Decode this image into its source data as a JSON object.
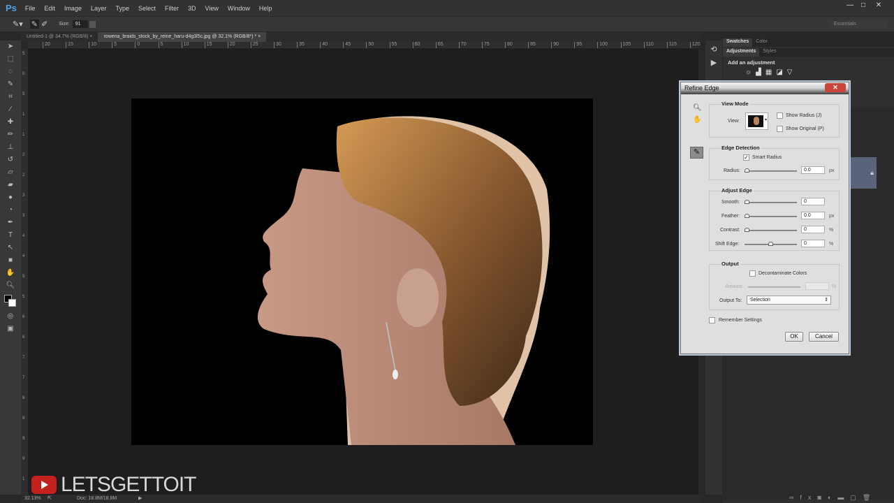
{
  "app": {
    "logo": "Ps",
    "menu": [
      "File",
      "Edit",
      "Image",
      "Layer",
      "Type",
      "Select",
      "Filter",
      "3D",
      "View",
      "Window",
      "Help"
    ],
    "window_buttons": [
      "—",
      "□",
      "✕"
    ],
    "workspace": "Essentials"
  },
  "options": {
    "size_label": "Size:",
    "size_value": "91"
  },
  "tabs": [
    {
      "label": "Untitled-1 @ 34.7% (RGB/8)",
      "close": "×"
    },
    {
      "label": "rowena_braids_stock_by_reine_haru-d4g3l5c.jpg @ 32.1% (RGB/8*) *",
      "close": "×"
    }
  ],
  "ruler_top": [
    "20",
    "15",
    "10",
    "5",
    "0",
    "5",
    "10",
    "15",
    "20",
    "25",
    "30",
    "35",
    "40",
    "45",
    "50",
    "55",
    "60",
    "65",
    "70",
    "75",
    "80",
    "85",
    "90",
    "95",
    "100",
    "105",
    "110",
    "115",
    "120"
  ],
  "ruler_left": [
    "5",
    "0",
    "5",
    "1",
    "1",
    "2",
    "2",
    "3",
    "3",
    "4",
    "4",
    "5",
    "5",
    "6",
    "6",
    "7",
    "7",
    "8",
    "8",
    "9",
    "9",
    "1"
  ],
  "status": {
    "zoom": "32.13%",
    "doc": "Doc: 18.8M/18.8M"
  },
  "watermark": "LETSGETTOIT",
  "panels": {
    "tabs1": [
      "Swatches",
      "Color"
    ],
    "tabs2": [
      "Adjustments",
      "Styles"
    ],
    "add_adjustment": "Add an adjustment"
  },
  "dialog": {
    "title": "Refine Edge",
    "close": "✕",
    "view_mode": {
      "title": "View Mode",
      "view_label": "View:",
      "show_radius": "Show Radius (J)",
      "show_original": "Show Original (P)",
      "show_radius_checked": false,
      "show_original_checked": false
    },
    "edge_detection": {
      "title": "Edge Detection",
      "smart_radius": "Smart Radius",
      "smart_radius_checked": true,
      "radius_label": "Radius:",
      "radius_value": "0.0",
      "radius_unit": "px"
    },
    "adjust_edge": {
      "title": "Adjust Edge",
      "smooth_label": "Smooth:",
      "smooth_value": "0",
      "feather_label": "Feather:",
      "feather_value": "0.0",
      "feather_unit": "px",
      "contrast_label": "Contrast:",
      "contrast_value": "0",
      "contrast_unit": "%",
      "shift_label": "Shift Edge:",
      "shift_value": "0",
      "shift_unit": "%"
    },
    "output": {
      "title": "Output",
      "decontaminate": "Decontaminate Colors",
      "decontaminate_checked": false,
      "amount_label": "Amount:",
      "amount_unit": "%",
      "output_to_label": "Output To:",
      "output_to_value": "Selection"
    },
    "remember": "Remember Settings",
    "remember_checked": false,
    "ok": "OK",
    "cancel": "Cancel"
  }
}
